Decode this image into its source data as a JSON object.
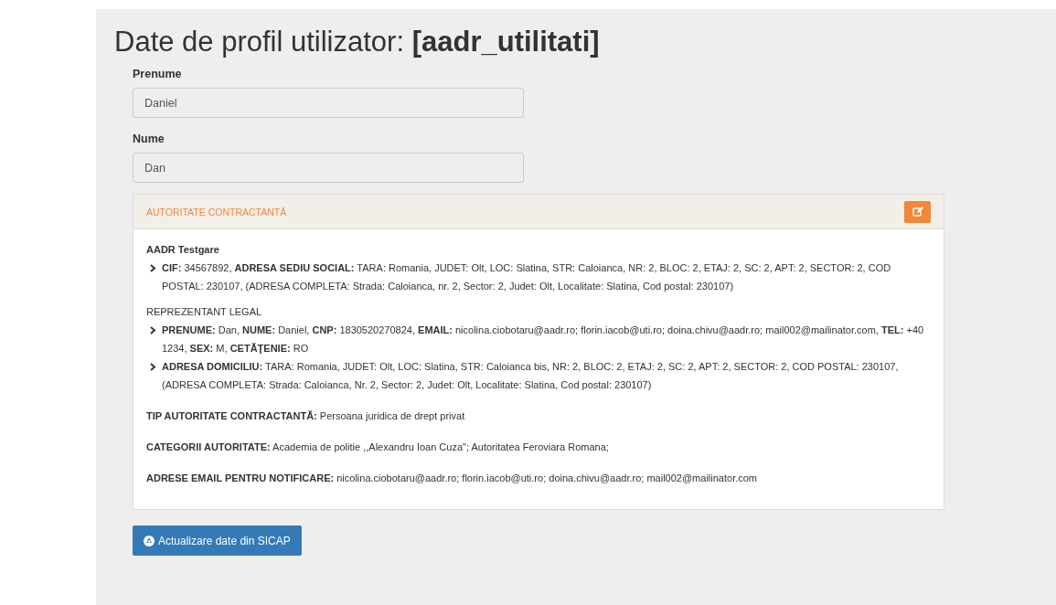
{
  "title": "Date de profil utilizator: **[aadr_utilitati]**",
  "fields": [
    {
      "label": "Prenume",
      "value": "Daniel"
    },
    {
      "label": "Nume",
      "value": "Dan"
    }
  ],
  "panel": {
    "title": "AUTORITATE CONTRACTANTĂ",
    "items": [
      {
        "kind": "heading",
        "text": "**AADR Testgare**"
      },
      {
        "kind": "detail",
        "text": "**CIF:** 34567892, **ADRESA SEDIU SOCIAL:** TARA: Romania, JUDET: Olt, LOC: Slatina, STR: Caloianca, NR: 2, BLOC: 2, ETAJ: 2, SC: 2, APT: 2, SECTOR: 2, COD POSTAL: 230107, (ADRESA COMPLETA: Strada: Caloianca, nr. 2, Sector: 2, Judet: Olt, Localitate: Slatina, Cod postal: 230107)"
      },
      {
        "kind": "heading",
        "text": "REPREZENTANT LEGAL"
      },
      {
        "kind": "detail",
        "text": "**PRENUME:** Dan, **NUME:** Daniel, **CNP:** 1830520270824, **EMAIL:** nicolina.ciobotaru@aadr.ro; florin.iacob@uti.ro; doina.chivu@aadr.ro; mail002@mailinator.com, **TEL:** +40 1234, **SEX:** M, **CETĂŢENIE:** RO"
      },
      {
        "kind": "detail",
        "text": "**ADRESA DOMICILIU:** TARA: Romania, JUDET: Olt, LOC: Slatina, STR: Caloianca bis, NR: 2, BLOC: 2, ETAJ: 2, SC: 2, APT: 2, SECTOR: 2, COD POSTAL: 230107, (ADRESA COMPLETA: Strada: Caloianca, Nr. 2, Sector: 2, Judet: Olt, Localitate: Slatina, Cod postal: 230107)"
      },
      {
        "kind": "line",
        "text": "**TIP AUTORITATE CONTRACTANTĂ:** Persoana juridica de drept privat"
      },
      {
        "kind": "line",
        "text": "**CATEGORII AUTORITATE:** Academia de politie ,,Alexandru Ioan Cuza\";   Autoritatea Feroviara Romana;"
      },
      {
        "kind": "line",
        "text": "**ADRESE EMAIL PENTRU NOTIFICARE:** nicolina.ciobotaru@aadr.ro; florin.iacob@uti.ro; doina.chivu@aadr.ro; mail002@mailinator.com"
      }
    ]
  },
  "button": "Actualizare date din SICAP"
}
